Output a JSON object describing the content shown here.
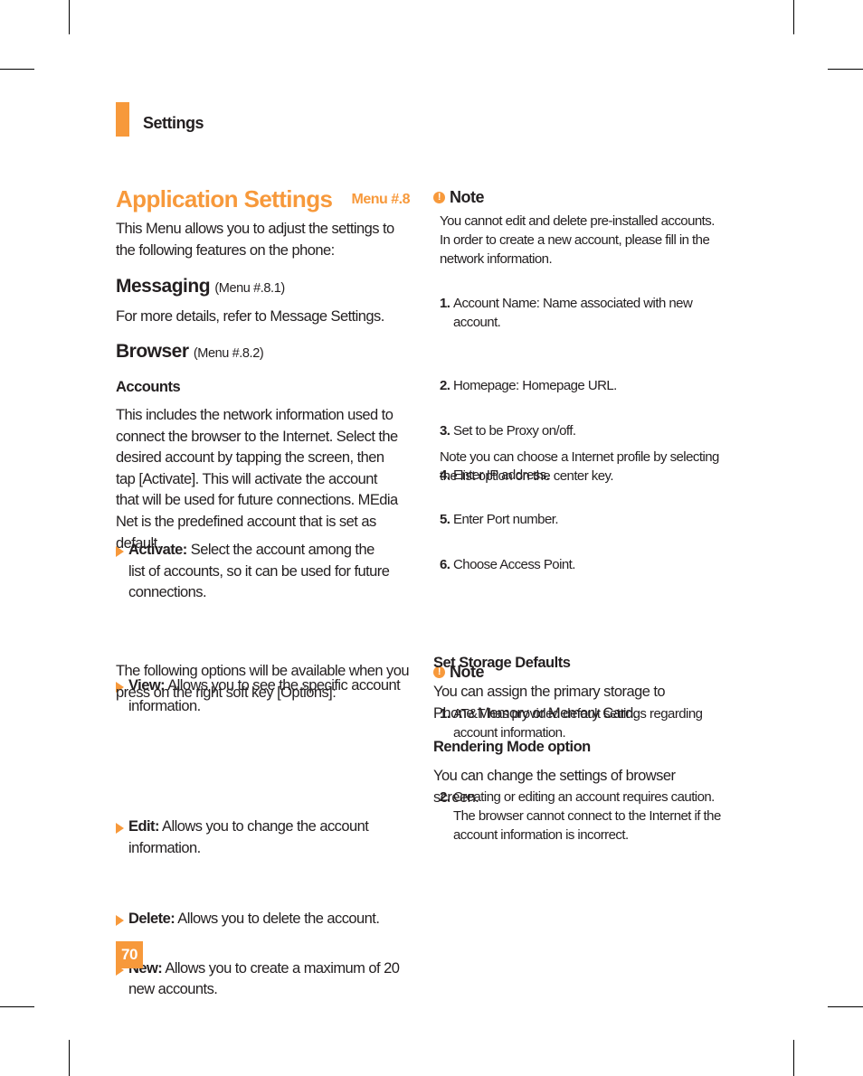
{
  "header": {
    "section": "Settings"
  },
  "title": {
    "heading": "Application Settings",
    "menu_ref": "Menu #.8"
  },
  "left": {
    "intro": "This Menu allows you to adjust the settings to the following features on the phone:",
    "messaging": {
      "heading": "Messaging",
      "menu_ref": "(Menu #.8.1)",
      "text": "For more details, refer to Message Settings."
    },
    "browser": {
      "heading": "Browser",
      "menu_ref": "(Menu #.8.2)"
    },
    "accounts": {
      "heading": "Accounts",
      "text": "This includes the network information used to connect the browser to the Internet. Select the desired account by tapping the screen, then tap [Activate]. This will activate the account that will be used for future connections. MEdia Net is the predefined account that is set as default."
    },
    "bullets_a": [
      {
        "term": "Activate:",
        "text": "Select the account among the list of accounts, so it can be used for future connections."
      },
      {
        "term": "View:",
        "text": "Allows you to see the specific account information."
      }
    ],
    "options_intro": "The following options will be available when you press on the right soft key [Options]:",
    "bullets_b": [
      {
        "term": "Edit:",
        "text": "Allows you to change the account information."
      },
      {
        "term": "Delete:",
        "text": "Allows you to delete the account."
      },
      {
        "term": "New:",
        "text": "Allows you to create a maximum of 20 new accounts."
      }
    ]
  },
  "right": {
    "note1": {
      "heading": "Note",
      "icon": "exclamation-icon",
      "text": "You cannot edit and delete pre-installed accounts. In order to create a new account, please fill in the network information.",
      "items": [
        {
          "n": "1.",
          "text": "Account Name: Name associated with new account."
        },
        {
          "n": "2.",
          "text": "Homepage: Homepage URL."
        },
        {
          "n": "3.",
          "text": "Set to be Proxy on/off."
        },
        {
          "n": "4.",
          "text": "Enter IP address."
        },
        {
          "n": "5.",
          "text": "Enter Port number."
        },
        {
          "n": "6.",
          "text": "Choose Access Point."
        }
      ],
      "footer": "Note you can choose a Internet profile by selecting the list option on the center key."
    },
    "note2": {
      "heading": "Note",
      "icon": "exclamation-icon",
      "items": [
        {
          "n": "1.",
          "text": "AT&T has provided default settings regarding account information."
        },
        {
          "n": "2.",
          "text": "Creating or editing an account requires caution. The browser cannot connect to the Internet if the account information is incorrect."
        }
      ]
    },
    "storage": {
      "heading": "Set Storage Defaults",
      "text": "You can assign the primary storage to Phone Memory or Memory Card."
    },
    "rendering": {
      "heading": "Rendering Mode option",
      "text": "You can change the settings of browser screen."
    }
  },
  "footer": {
    "page_number": "70"
  },
  "colors": {
    "accent": "#f7993b",
    "text": "#231f20"
  }
}
